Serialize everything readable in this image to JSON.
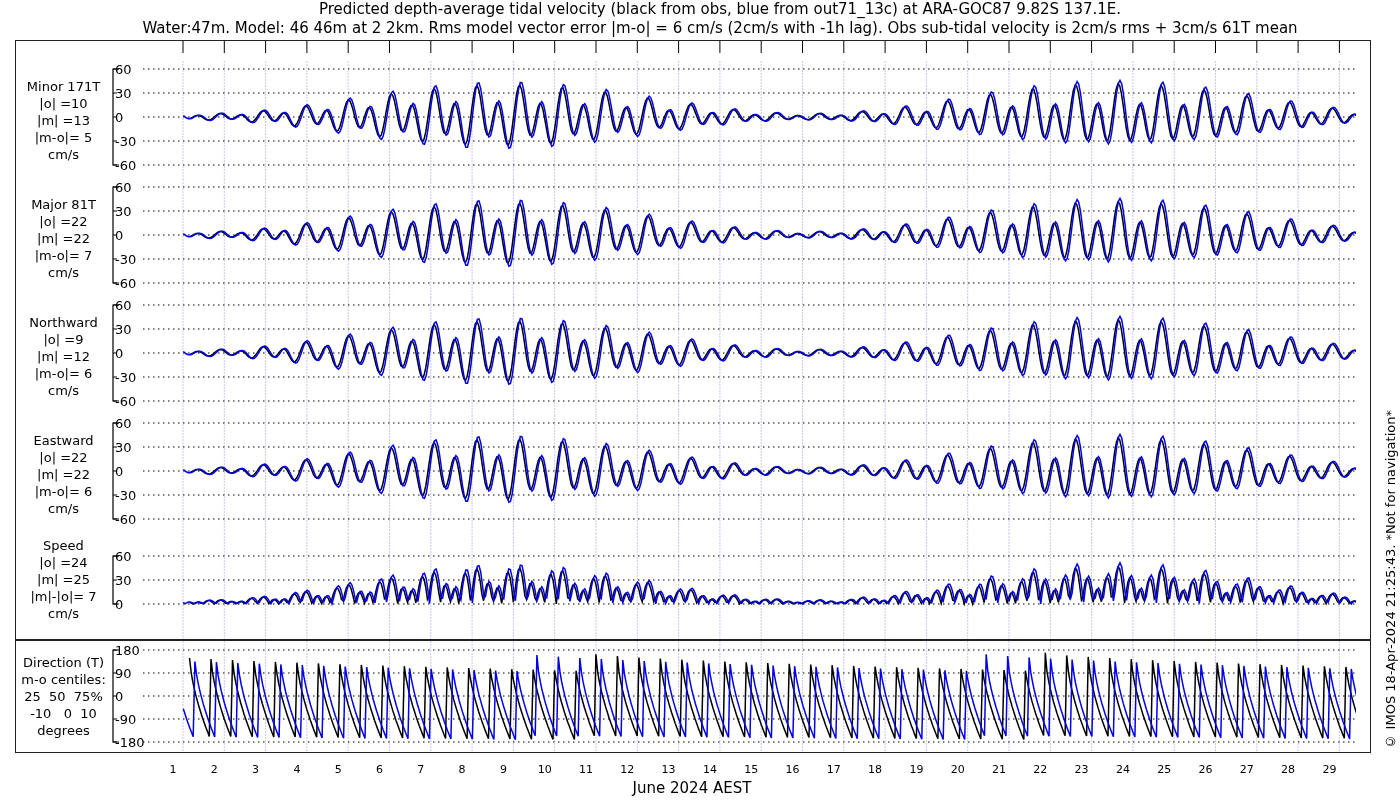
{
  "title": [
    "Predicted depth-average tidal velocity (black from obs, blue from out71_13c) at ARA-GOC87 9.82S 137.1E.",
    "Water:47m. Model: 46 46m at 2 2km. Rms model vector error |m-o| = 6 cm/s (2cm/s with -1h lag). Obs sub-tidal velocity is 2cm/s rms + 3cm/s 61T mean"
  ],
  "panels": [
    {
      "kind": "velocity",
      "label_lines": [
        "Minor 171T",
        "|o| =10",
        "|m| =13",
        "|m-o|= 5",
        "cm/s"
      ],
      "yticks": [
        "60",
        "30",
        "0",
        "-30",
        "-60"
      ]
    },
    {
      "kind": "velocity",
      "label_lines": [
        "Major 81T",
        "|o| =22",
        "|m| =22",
        "|m-o|= 7",
        "cm/s"
      ],
      "yticks": [
        "60",
        "30",
        "0",
        "-30",
        "-60"
      ]
    },
    {
      "kind": "velocity",
      "label_lines": [
        "Northward",
        "|o| =9",
        "|m| =12",
        "|m-o|= 6",
        "cm/s"
      ],
      "yticks": [
        "60",
        "30",
        "0",
        "-30",
        "-60"
      ]
    },
    {
      "kind": "velocity",
      "label_lines": [
        "Eastward",
        "|o| =22",
        "|m| =22",
        "|m-o|= 6",
        "cm/s"
      ],
      "yticks": [
        "60",
        "30",
        "0",
        "-30",
        "-60"
      ]
    },
    {
      "kind": "speed",
      "label_lines": [
        "Speed",
        "|o| =24",
        "|m| =25",
        "|m|-|o|= 7",
        "cm/s"
      ],
      "yticks": [
        "60",
        "30",
        "0"
      ]
    },
    {
      "kind": "direction",
      "label_lines": [
        "Direction (T)",
        "m-o centiles:",
        "25  50  75%",
        "-10   0  10",
        "degrees"
      ],
      "yticks": [
        "180",
        "90",
        "0",
        "-90",
        "-180"
      ]
    }
  ],
  "x_axis": {
    "day_labels": [
      "1",
      "2",
      "3",
      "4",
      "5",
      "6",
      "7",
      "8",
      "9",
      "10",
      "11",
      "12",
      "13",
      "14",
      "15",
      "16",
      "17",
      "18",
      "19",
      "20",
      "21",
      "22",
      "23",
      "24",
      "25",
      "26",
      "27",
      "28",
      "29"
    ],
    "label": "June 2024 AEST"
  },
  "credit": "© IMOS 18-Apr-2024 21:25:43. *Not for navigation*"
}
